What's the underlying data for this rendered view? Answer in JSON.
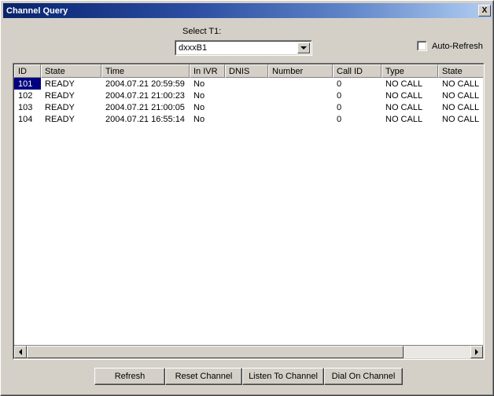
{
  "window": {
    "title": "Channel Query",
    "close_label": "×",
    "close_glyph": "X"
  },
  "toolbar": {
    "select_label": "Select T1:",
    "combo_value": "dxxxB1",
    "combo_arrow_icon": "chevron-down-icon",
    "autorefresh_label": "Auto-Refresh",
    "autorefresh_checked": false
  },
  "table": {
    "columns": [
      {
        "label": "ID",
        "width": 34
      },
      {
        "label": "State",
        "width": 77
      },
      {
        "label": "Time",
        "width": 112
      },
      {
        "label": "In IVR",
        "width": 45
      },
      {
        "label": "DNIS",
        "width": 55
      },
      {
        "label": "Number",
        "width": 82
      },
      {
        "label": "Call ID",
        "width": 62
      },
      {
        "label": "Type",
        "width": 72
      },
      {
        "label": "State",
        "width": 59
      }
    ],
    "rows": [
      {
        "selected": true,
        "cells": [
          "101",
          "READY",
          "2004.07.21 20:59:59",
          "No",
          "",
          "",
          "0",
          "NO CALL",
          "NO CALL"
        ]
      },
      {
        "selected": false,
        "cells": [
          "102",
          "READY",
          "2004.07.21 21:00:23",
          "No",
          "",
          "",
          "0",
          "NO CALL",
          "NO CALL"
        ]
      },
      {
        "selected": false,
        "cells": [
          "103",
          "READY",
          "2004.07.21 21:00:05",
          "No",
          "",
          "",
          "0",
          "NO CALL",
          "NO CALL"
        ]
      },
      {
        "selected": false,
        "cells": [
          "104",
          "READY",
          "2004.07.21 16:55:14",
          "No",
          "",
          "",
          "0",
          "NO CALL",
          "NO CALL"
        ]
      }
    ]
  },
  "scrollbar": {
    "left_icon": "arrow-left-icon",
    "right_icon": "arrow-right-icon",
    "thumb_percent": 85
  },
  "buttons": {
    "refresh": "Refresh",
    "reset_channel": "Reset Channel",
    "listen_to_channel": "Listen To Channel",
    "dial_on_channel": "Dial On Channel"
  },
  "colors": {
    "title_gradient_start": "#0a246a",
    "title_gradient_end": "#b6cdf0",
    "face": "#d4d0c8",
    "selection": "#000080",
    "list_background": "#ffffff"
  }
}
